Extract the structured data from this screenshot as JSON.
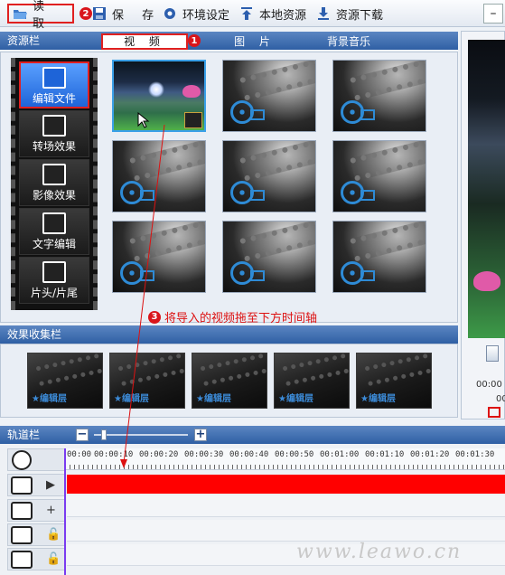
{
  "toolbar": {
    "open_label": "读 取",
    "open_badge": "2",
    "save_label": "保 存",
    "settings_label": "环境设定",
    "local_label": "本地资源",
    "download_label": "资源下载",
    "minimize_label": "–"
  },
  "resource_panel": {
    "title": "资源栏",
    "tabs": [
      "视 频",
      "图 片",
      "背景音乐"
    ],
    "tab_badge": "1",
    "sidebar": [
      "编辑文件",
      "转场效果",
      "影像效果",
      "文字编辑",
      "片头/片尾"
    ]
  },
  "instruction": {
    "badge": "3",
    "text": "将导入的视频拖至下方时间轴"
  },
  "effects_panel": {
    "title": "效果收集栏",
    "item_label": "★编辑层"
  },
  "preview": {
    "time_1": "00:00",
    "time_2": "00"
  },
  "track_panel": {
    "title": "轨道栏",
    "zoom_out": "−",
    "zoom_in": "+",
    "ruler_ticks": [
      "00:00",
      "00:00:10",
      "00:00:20",
      "00:00:30",
      "00:00:40",
      "00:00:50",
      "00:01:00",
      "00:01:10",
      "00:01:20",
      "00:01:30"
    ],
    "play_symbol": "▶",
    "add_symbol": "+"
  },
  "watermark": "www.leawo.cn",
  "colors": {
    "panel_header": "#2f5fa4",
    "highlight_border": "#e02020",
    "video_clip": "#ff0000",
    "playhead": "#7a3cf0",
    "badge": "#d9151b"
  }
}
